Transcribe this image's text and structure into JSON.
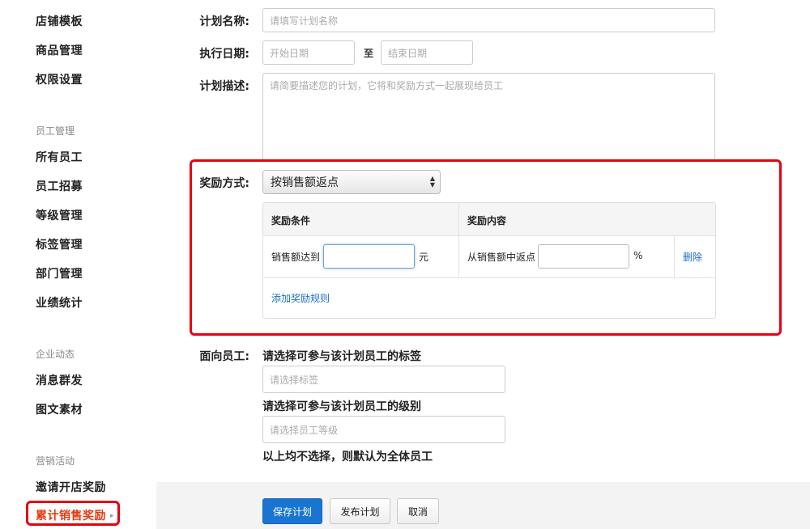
{
  "sidebar": {
    "items_top": [
      "店铺模板",
      "商品管理",
      "权限设置"
    ],
    "group_staff": "员工管理",
    "items_staff": [
      "所有员工",
      "员工招募",
      "等级管理",
      "标签管理",
      "部门管理",
      "业绩统计"
    ],
    "group_news": "企业动态",
    "items_news": [
      "消息群发",
      "图文素材"
    ],
    "group_marketing": "营销活动",
    "items_marketing": [
      "邀请开店奖励",
      "累计销售奖励"
    ],
    "arrow": "▸"
  },
  "form": {
    "name_label": "计划名称:",
    "name_placeholder": "请填写计划名称",
    "date_label": "执行日期:",
    "start_placeholder": "开始日期",
    "to_text": "至",
    "end_placeholder": "结束日期",
    "desc_label": "计划描述:",
    "desc_placeholder": "请简要描述您的计划，它将和奖励方式一起展现给员工"
  },
  "reward": {
    "label": "奖励方式:",
    "selected": "按销售额返点",
    "col_condition": "奖励条件",
    "col_content": "奖励内容",
    "cond_prefix": "销售额达到",
    "cond_value": "",
    "cond_unit": "元",
    "content_prefix": "从销售额中返点",
    "content_value": "",
    "content_unit": "%",
    "delete_link": "删除",
    "add_rule_link": "添加奖励规则"
  },
  "target": {
    "label": "面向员工:",
    "tag_hint": "请选择可参与该计划员工的标签",
    "tag_placeholder": "请选择标签",
    "level_hint": "请选择可参与该计划员工的级别",
    "level_placeholder": "请选择员工等级",
    "default_note": "以上均不选择，则默认为全体员工"
  },
  "footer": {
    "save": "保存计划",
    "publish": "发布计划",
    "cancel": "取消"
  },
  "colors": {
    "primary": "#1a75d2",
    "highlight": "#e60012",
    "active_nav": "#e8380d",
    "link": "#1e6fc9"
  }
}
